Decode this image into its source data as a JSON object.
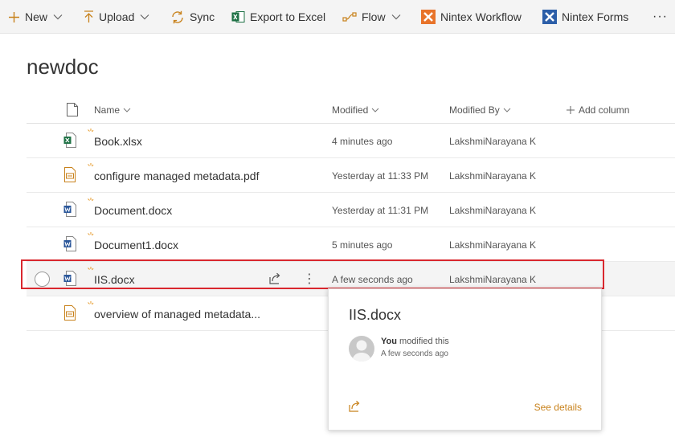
{
  "toolbar": {
    "new_label": "New",
    "upload_label": "Upload",
    "sync_label": "Sync",
    "export_label": "Export to Excel",
    "flow_label": "Flow",
    "nintex_workflow_label": "Nintex Workflow",
    "nintex_forms_label": "Nintex Forms",
    "more_label": "···"
  },
  "library": {
    "title": "newdoc"
  },
  "columns": {
    "name": "Name",
    "modified": "Modified",
    "modified_by": "Modified By",
    "add_column": "Add column"
  },
  "files": [
    {
      "name": "Book.xlsx",
      "type": "xlsx-icon",
      "modified": "4 minutes ago",
      "modified_by": "LakshmiNarayana K"
    },
    {
      "name": "configure managed metadata.pdf",
      "type": "pdf-icon",
      "modified": "Yesterday at 11:33 PM",
      "modified_by": "LakshmiNarayana K"
    },
    {
      "name": "Document.docx",
      "type": "docx-icon",
      "modified": "Yesterday at 11:31 PM",
      "modified_by": "LakshmiNarayana K"
    },
    {
      "name": "Document1.docx",
      "type": "docx-icon",
      "modified": "5 minutes ago",
      "modified_by": "LakshmiNarayana K"
    },
    {
      "name": "IIS.docx",
      "type": "docx-icon",
      "modified": "A few seconds ago",
      "modified_by": "LakshmiNarayana K"
    },
    {
      "name": "overview of managed metadata...",
      "type": "pdf-icon",
      "modified": "",
      "modified_by": ""
    }
  ],
  "more_actions_label": "⋮",
  "hover_card": {
    "title": "IIS.docx",
    "actor": "You",
    "action": " modified this",
    "when": "A few seconds ago",
    "see_details": "See details"
  },
  "colors": {
    "accent": "#c8821c",
    "selection_border": "#d9272e",
    "excel_green": "#1e7145",
    "word_blue": "#2b579a",
    "nintex_orange": "#e8732a",
    "nintex_blue": "#2c5ea8"
  }
}
